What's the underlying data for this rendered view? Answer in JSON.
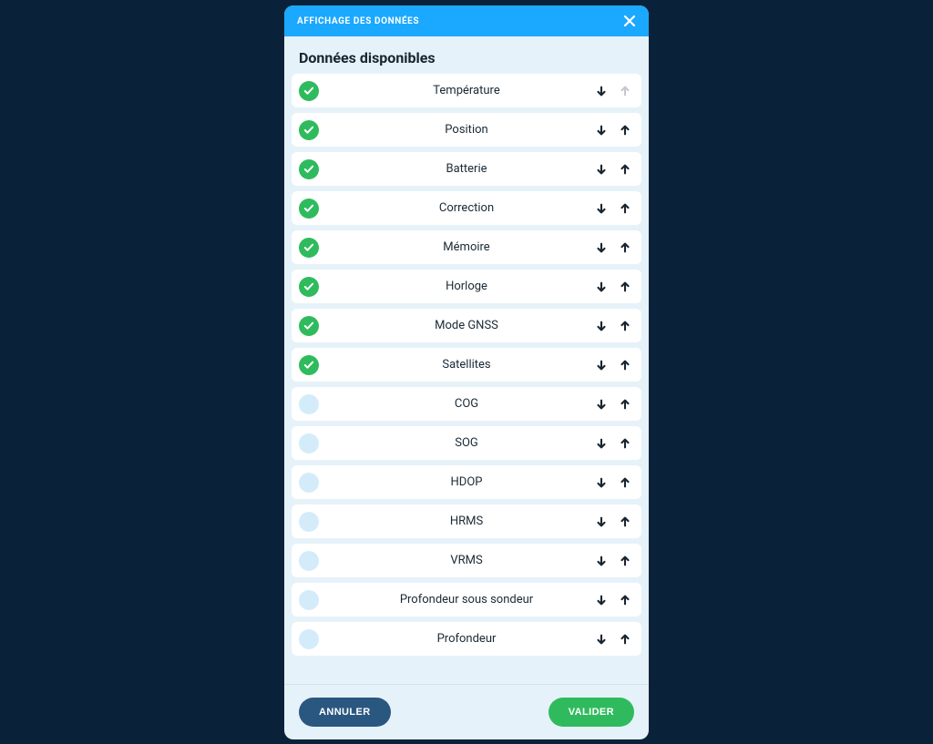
{
  "header": {
    "title": "AFFICHAGE DES DONNÉES"
  },
  "section_title": "Données disponibles",
  "items": [
    {
      "label": "Température",
      "checked": true,
      "up_disabled": true,
      "down_disabled": false
    },
    {
      "label": "Position",
      "checked": true,
      "up_disabled": false,
      "down_disabled": false
    },
    {
      "label": "Batterie",
      "checked": true,
      "up_disabled": false,
      "down_disabled": false
    },
    {
      "label": "Correction",
      "checked": true,
      "up_disabled": false,
      "down_disabled": false
    },
    {
      "label": "Mémoire",
      "checked": true,
      "up_disabled": false,
      "down_disabled": false
    },
    {
      "label": "Horloge",
      "checked": true,
      "up_disabled": false,
      "down_disabled": false
    },
    {
      "label": "Mode GNSS",
      "checked": true,
      "up_disabled": false,
      "down_disabled": false
    },
    {
      "label": "Satellites",
      "checked": true,
      "up_disabled": false,
      "down_disabled": false
    },
    {
      "label": "COG",
      "checked": false,
      "up_disabled": false,
      "down_disabled": false
    },
    {
      "label": "SOG",
      "checked": false,
      "up_disabled": false,
      "down_disabled": false
    },
    {
      "label": "HDOP",
      "checked": false,
      "up_disabled": false,
      "down_disabled": false
    },
    {
      "label": "HRMS",
      "checked": false,
      "up_disabled": false,
      "down_disabled": false
    },
    {
      "label": "VRMS",
      "checked": false,
      "up_disabled": false,
      "down_disabled": false
    },
    {
      "label": "Profondeur sous sondeur",
      "checked": false,
      "up_disabled": false,
      "down_disabled": false
    },
    {
      "label": "Profondeur",
      "checked": false,
      "up_disabled": false,
      "down_disabled": false
    }
  ],
  "footer": {
    "cancel_label": "ANNULER",
    "confirm_label": "VALIDER"
  }
}
